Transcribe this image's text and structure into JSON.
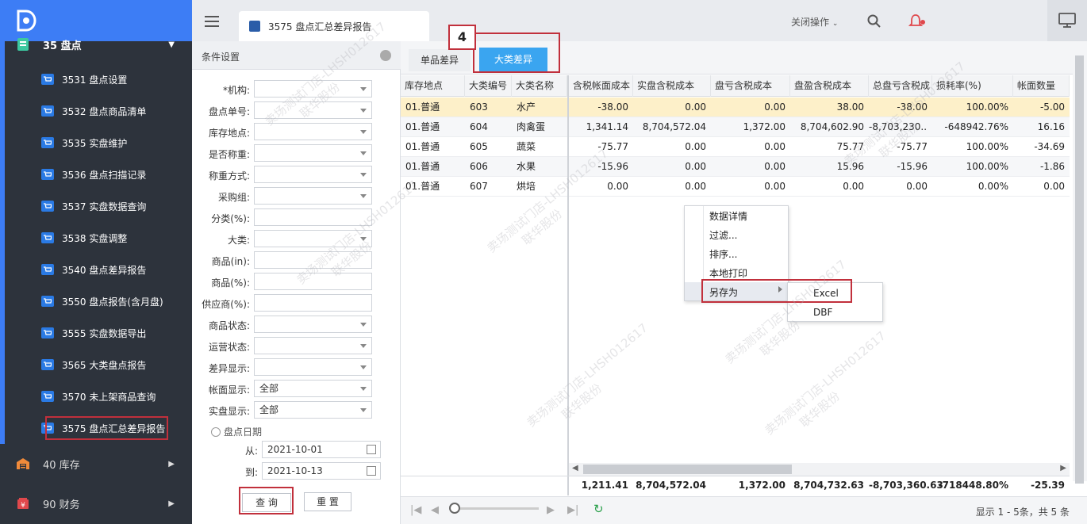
{
  "colors": {
    "brand": "#3d7df5",
    "sidebar_bg": "#2d333c",
    "active_tab": "#3aa5f0",
    "highlight_row": "#fdf0c9",
    "annotation": "#c1303c"
  },
  "sidebar": {
    "logo_icon": "app-logo-icon",
    "group_open": {
      "label": "35 盘点",
      "icon": "inventory-count-icon"
    },
    "items": [
      {
        "label": "3531 盘点设置"
      },
      {
        "label": "3532 盘点商品清单"
      },
      {
        "label": "3535 实盘维护"
      },
      {
        "label": "3536 盘点扫描记录"
      },
      {
        "label": "3537 实盘数据查询"
      },
      {
        "label": "3538 实盘调整"
      },
      {
        "label": "3540 盘点差异报告"
      },
      {
        "label": "3550 盘点报告(含月盘)"
      },
      {
        "label": "3555 实盘数据导出"
      },
      {
        "label": "3565 大类盘点报告"
      },
      {
        "label": "3570 未上架商品查询"
      },
      {
        "label": "3575 盘点汇总差异报告"
      }
    ],
    "groups_closed": [
      {
        "label": "40 库存",
        "icon": "warehouse-icon"
      },
      {
        "label": "90 财务",
        "icon": "finance-icon"
      }
    ]
  },
  "topbar": {
    "tab_label": "3575 盘点汇总差异报告",
    "close_ops": "关闭操作",
    "icons": [
      "menu-icon",
      "search-icon",
      "bell-icon",
      "monitor-icon"
    ]
  },
  "conditions": {
    "title": "条件设置",
    "fields": [
      {
        "label": "*机构:",
        "value": "",
        "select": true
      },
      {
        "label": "盘点单号:",
        "value": "",
        "select": true
      },
      {
        "label": "库存地点:",
        "value": "",
        "select": true
      },
      {
        "label": "是否称重:",
        "value": "",
        "select": true
      },
      {
        "label": "称重方式:",
        "value": "",
        "select": true
      },
      {
        "label": "采购组:",
        "value": "",
        "select": true
      },
      {
        "label": "分类(%):",
        "value": "",
        "select": false
      },
      {
        "label": "大类:",
        "value": "",
        "select": true
      },
      {
        "label": "商品(in):",
        "value": "",
        "select": false
      },
      {
        "label": "商品(%):",
        "value": "",
        "select": false
      },
      {
        "label": "供应商(%):",
        "value": "",
        "select": false
      },
      {
        "label": "商品状态:",
        "value": "",
        "select": true
      },
      {
        "label": "运营状态:",
        "value": "",
        "select": true
      },
      {
        "label": "差异显示:",
        "value": "",
        "select": true
      },
      {
        "label": "帐面显示:",
        "value": "全部",
        "select": true
      },
      {
        "label": "实盘显示:",
        "value": "全部",
        "select": true
      }
    ],
    "date_section": "盘点日期",
    "from_label": "从:",
    "from_value": "2021-10-01",
    "to_label": "到:",
    "to_value": "2021-10-13",
    "query_btn": "查 询",
    "reset_btn": "重 置"
  },
  "subtabs": [
    {
      "label": "单品差异"
    },
    {
      "label": "大类差异"
    }
  ],
  "step_badge": "4",
  "table": {
    "columns": [
      "库存地点",
      "大类编号",
      "大类名称",
      "含税帐面成本",
      "实盘含税成本",
      "盘亏含税成本",
      "盘盈含税成本",
      "总盘亏含税成",
      "损耗率(%)",
      "帐面数量"
    ],
    "rows": [
      [
        "01.普通",
        "603",
        "水产",
        "-38.00",
        "0.00",
        "0.00",
        "38.00",
        "-38.00",
        "100.00%",
        "-5.00"
      ],
      [
        "01.普通",
        "604",
        "肉禽蛋",
        "1,341.14",
        "8,704,572.04",
        "1,372.00",
        "8,704,602.90",
        "-8,703,230...",
        "-648942.76%",
        "16.16"
      ],
      [
        "01.普通",
        "605",
        "蔬菜",
        "-75.77",
        "0.00",
        "0.00",
        "75.77",
        "-75.77",
        "100.00%",
        "-34.69"
      ],
      [
        "01.普通",
        "606",
        "水果",
        "-15.96",
        "0.00",
        "0.00",
        "15.96",
        "-15.96",
        "100.00%",
        "-1.86"
      ],
      [
        "01.普通",
        "607",
        "烘培",
        "0.00",
        "0.00",
        "0.00",
        "0.00",
        "0.00",
        "0.00%",
        "0.00"
      ]
    ],
    "totals": [
      "1,211.41",
      "8,704,572.04",
      "1,372.00",
      "8,704,732.63",
      "-8,703,360.63",
      "-718448.80%",
      "-25.39"
    ]
  },
  "context_menu": {
    "items": [
      {
        "label": "数据详情"
      },
      {
        "label": "过滤..."
      },
      {
        "label": "排序..."
      },
      {
        "label": "本地打印"
      },
      {
        "label": "另存为"
      }
    ],
    "submenu": [
      {
        "label": "Excel"
      },
      {
        "label": "DBF"
      }
    ]
  },
  "pager": {
    "count_text": "显示 1 - 5条，共 5 条"
  },
  "watermark": {
    "line1": "卖场测试门店-LHSH012617",
    "line2": "联华股份"
  }
}
